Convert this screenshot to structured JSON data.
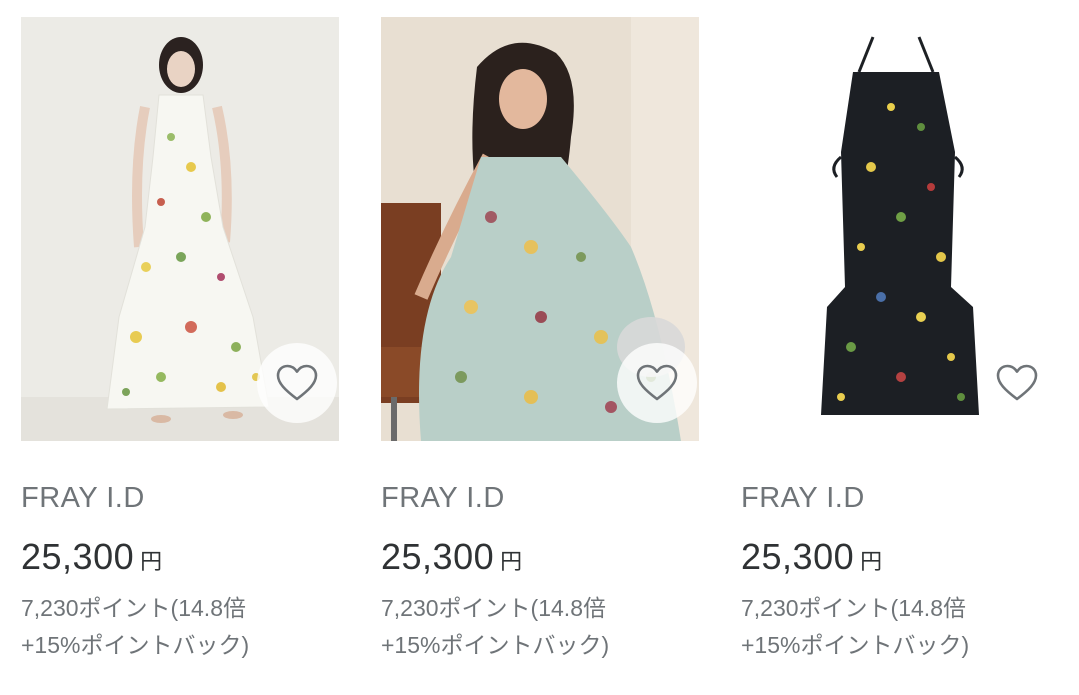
{
  "products": [
    {
      "brand": "FRAY I.D",
      "price": "25,300",
      "currency": "円",
      "points_line1": "7,230ポイント(14.8倍",
      "points_line2": "+15%ポイントバック)",
      "favorite_icon": "heart-outline-icon"
    },
    {
      "brand": "FRAY I.D",
      "price": "25,300",
      "currency": "円",
      "points_line1": "7,230ポイント(14.8倍",
      "points_line2": "+15%ポイントバック)",
      "favorite_icon": "heart-outline-icon"
    },
    {
      "brand": "FRAY I.D",
      "price": "25,300",
      "currency": "円",
      "points_line1": "7,230ポイント(14.8倍",
      "points_line2": "+15%ポイントバック)",
      "favorite_icon": "heart-outline-icon"
    }
  ],
  "colors": {
    "brand_text": "#6f7478",
    "price_text": "#2f3234",
    "heart_stroke": "#6f7478"
  }
}
